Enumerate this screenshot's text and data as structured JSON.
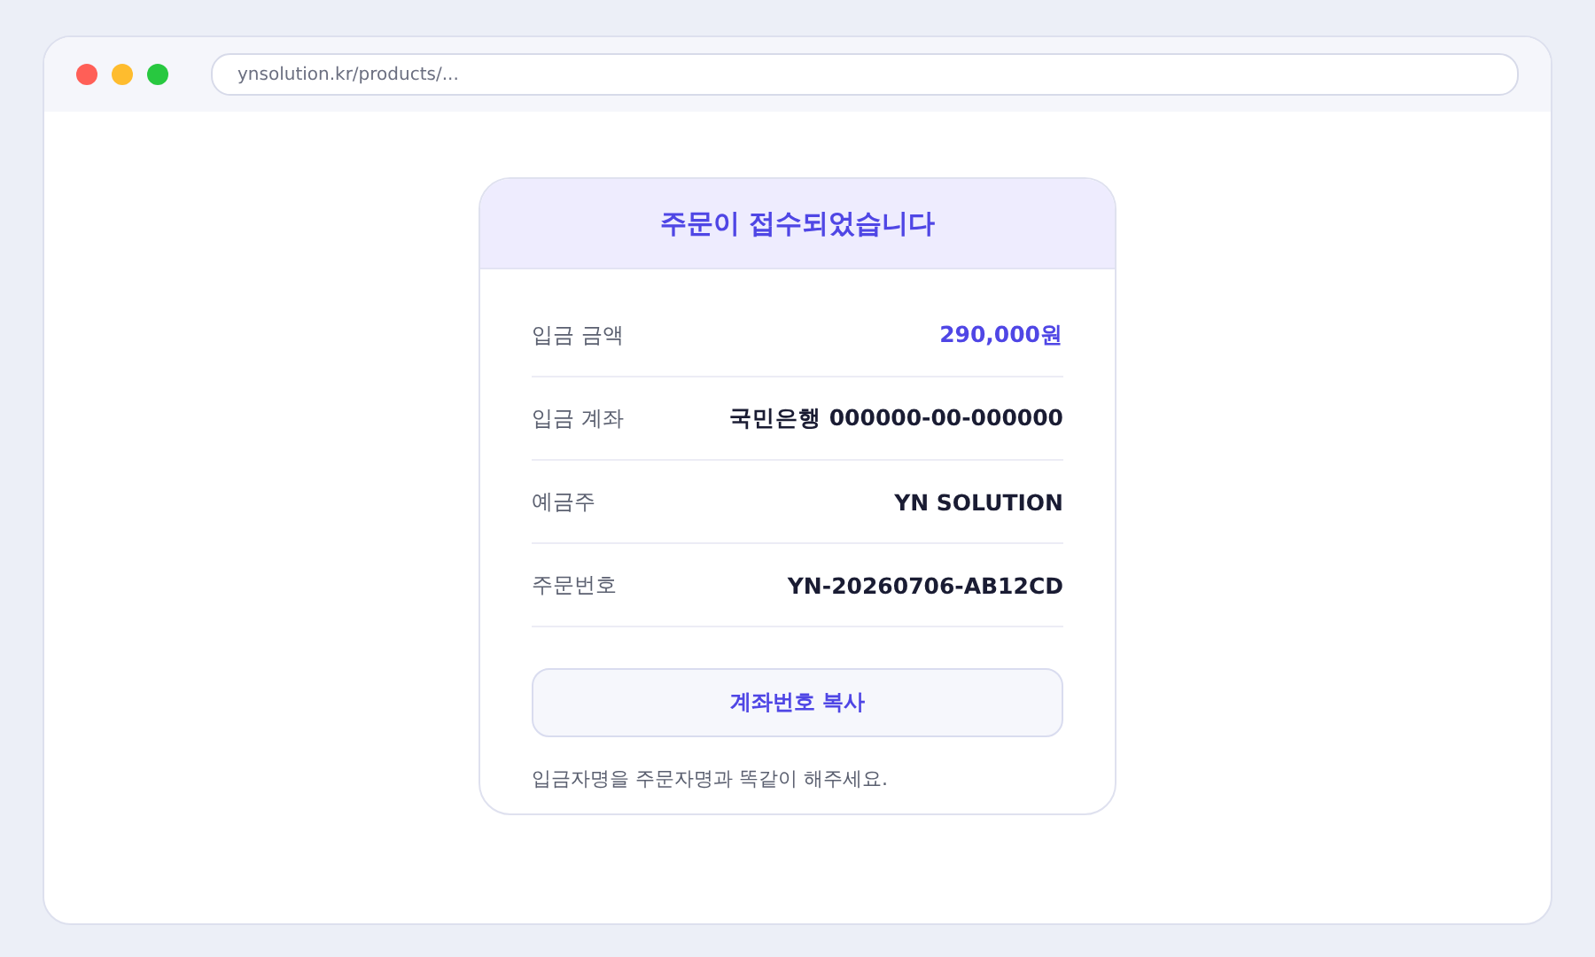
{
  "browser": {
    "url": "ynsolution.kr/products/..."
  },
  "card": {
    "title": "주문이 접수되었습니다",
    "rows": [
      {
        "label": "입금 금액",
        "value": "290,000원",
        "highlight": true
      },
      {
        "label": "입금 계좌",
        "value": "국민은행 000000-00-000000",
        "highlight": false
      },
      {
        "label": "예금주",
        "value": "YN SOLUTION",
        "highlight": false
      },
      {
        "label": "주문번호",
        "value": "YN-20260706-AB12CD",
        "highlight": false
      }
    ],
    "button": "계좌번호 복사",
    "note": "입금자명을 주문자명과 똑같이 해주세요."
  }
}
